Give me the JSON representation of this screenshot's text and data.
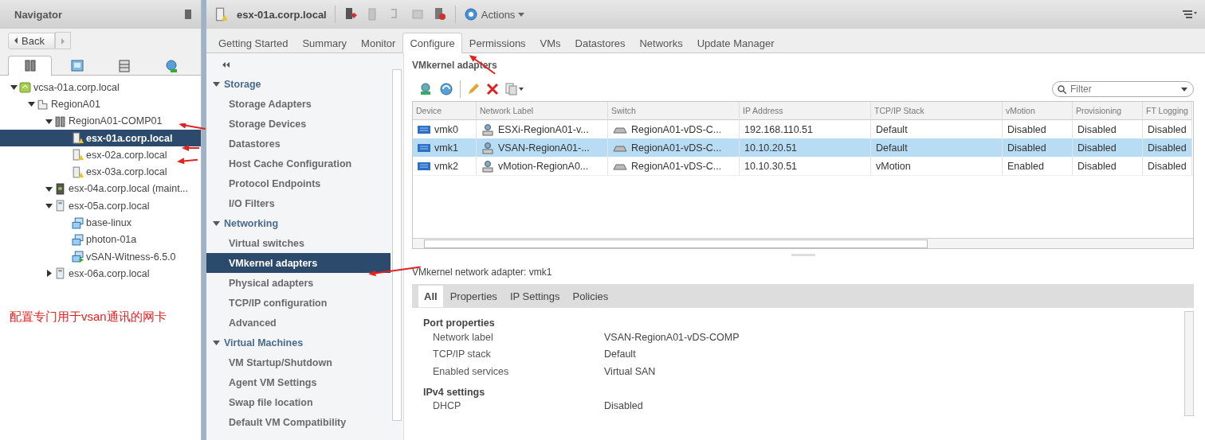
{
  "navigator": {
    "title": "Navigator",
    "back": "Back",
    "tabs": [
      {
        "kind": "hosts",
        "selected": true
      },
      {
        "kind": "vms",
        "selected": false
      },
      {
        "kind": "storage",
        "selected": false
      },
      {
        "kind": "network",
        "selected": false
      }
    ],
    "tree": [
      {
        "label": "vcsa-01a.corp.local",
        "kind": "vcenter",
        "selected": false,
        "expanded": true,
        "children": [
          {
            "label": "RegionA01",
            "kind": "datacenter",
            "selected": false,
            "expanded": true,
            "children": [
              {
                "label": "RegionA01-COMP01",
                "kind": "cluster",
                "selected": false,
                "expanded": true,
                "children": [
                  {
                    "label": "esx-01a.corp.local",
                    "kind": "host-warning",
                    "selected": true
                  },
                  {
                    "label": "esx-02a.corp.local",
                    "kind": "host-warning",
                    "selected": false
                  },
                  {
                    "label": "esx-03a.corp.local",
                    "kind": "host-warning",
                    "selected": false
                  }
                ]
              },
              {
                "label": "esx-04a.corp.local (maint...",
                "kind": "host-maintenance",
                "selected": false,
                "expanded": true
              },
              {
                "label": "esx-05a.corp.local",
                "kind": "host",
                "selected": false,
                "expanded": true,
                "children": [
                  {
                    "label": "base-linux",
                    "kind": "vm",
                    "selected": false
                  },
                  {
                    "label": "photon-01a",
                    "kind": "vm",
                    "selected": false
                  },
                  {
                    "label": "vSAN-Witness-6.5.0",
                    "kind": "vm-green",
                    "selected": false
                  }
                ]
              },
              {
                "label": "esx-06a.corp.local",
                "kind": "host",
                "selected": false,
                "expanded": false
              }
            ]
          }
        ]
      }
    ]
  },
  "annotation": "配置专门用于vsan通讯的网卡",
  "object": {
    "title": "esx-01a.corp.local",
    "actions": "Actions"
  },
  "tabs": [
    {
      "label": "Getting Started",
      "selected": false
    },
    {
      "label": "Summary",
      "selected": false
    },
    {
      "label": "Monitor",
      "selected": false
    },
    {
      "label": "Configure",
      "selected": true
    },
    {
      "label": "Permissions",
      "selected": false
    },
    {
      "label": "VMs",
      "selected": false
    },
    {
      "label": "Datastores",
      "selected": false
    },
    {
      "label": "Networks",
      "selected": false
    },
    {
      "label": "Update Manager",
      "selected": false
    }
  ],
  "config_nav": [
    {
      "title": "Storage",
      "expanded": true,
      "items": [
        {
          "label": "Storage Adapters",
          "selected": false
        },
        {
          "label": "Storage Devices",
          "selected": false
        },
        {
          "label": "Datastores",
          "selected": false
        },
        {
          "label": "Host Cache Configuration",
          "selected": false
        },
        {
          "label": "Protocol Endpoints",
          "selected": false
        },
        {
          "label": "I/O Filters",
          "selected": false
        }
      ]
    },
    {
      "title": "Networking",
      "expanded": true,
      "items": [
        {
          "label": "Virtual switches",
          "selected": false
        },
        {
          "label": "VMkernel adapters",
          "selected": true
        },
        {
          "label": "Physical adapters",
          "selected": false
        },
        {
          "label": "TCP/IP configuration",
          "selected": false
        },
        {
          "label": "Advanced",
          "selected": false
        }
      ]
    },
    {
      "title": "Virtual Machines",
      "expanded": true,
      "items": [
        {
          "label": "VM Startup/Shutdown",
          "selected": false
        },
        {
          "label": "Agent VM Settings",
          "selected": false
        },
        {
          "label": "Swap file location",
          "selected": false
        },
        {
          "label": "Default VM Compatibility",
          "selected": false
        }
      ]
    }
  ],
  "vmkernel": {
    "title": "VMkernel adapters",
    "filter": {
      "placeholder": "Filter"
    },
    "table": {
      "columns": [
        "Device",
        "Network Label",
        "Switch",
        "IP Address",
        "TCP/IP Stack",
        "vMotion",
        "Provisioning",
        "FT Logging"
      ],
      "rows": [
        {
          "selected": false,
          "cells": [
            "vmk0",
            "ESXi-RegionA01-v...",
            "RegionA01-vDS-C...",
            "192.168.110.51",
            "Default",
            "Disabled",
            "Disabled",
            "Disabled"
          ]
        },
        {
          "selected": true,
          "cells": [
            "vmk1",
            "VSAN-RegionA01-...",
            "RegionA01-vDS-C...",
            "10.10.20.51",
            "Default",
            "Disabled",
            "Disabled",
            "Disabled"
          ]
        },
        {
          "selected": false,
          "cells": [
            "vmk2",
            "vMotion-RegionA0...",
            "RegionA01-vDS-C...",
            "10.10.30.51",
            "vMotion",
            "Enabled",
            "Disabled",
            "Disabled"
          ]
        }
      ]
    }
  },
  "details": {
    "title": "VMkernel network adapter: vmk1",
    "tabs": [
      {
        "label": "All",
        "selected": true
      },
      {
        "label": "Properties",
        "selected": false
      },
      {
        "label": "IP Settings",
        "selected": false
      },
      {
        "label": "Policies",
        "selected": false
      }
    ],
    "sections": [
      {
        "title": "Port properties",
        "rows": [
          {
            "label": "Network label",
            "value": "VSAN-RegionA01-vDS-COMP"
          },
          {
            "label": "TCP/IP stack",
            "value": "Default"
          },
          {
            "label": "Enabled services",
            "value": "Virtual SAN"
          }
        ]
      },
      {
        "title": "IPv4 settings",
        "rows": [
          {
            "label": "DHCP",
            "value": "Disabled"
          }
        ]
      }
    ]
  }
}
